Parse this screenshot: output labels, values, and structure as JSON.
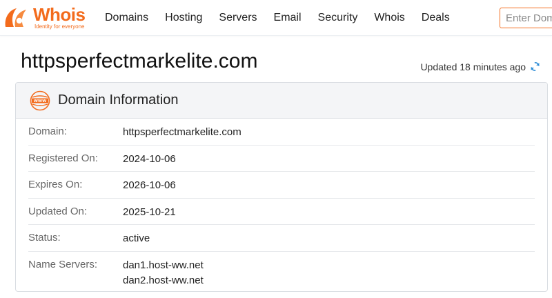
{
  "brand": {
    "name": "Whois",
    "tagline": "Identity for everyone",
    "accent_color": "#f36b1c",
    "icon": "whois-logo-icon"
  },
  "nav": {
    "items": [
      "Domains",
      "Hosting",
      "Servers",
      "Email",
      "Security",
      "Whois",
      "Deals"
    ]
  },
  "search": {
    "placeholder": "Enter Domain or IP",
    "value": ""
  },
  "page": {
    "title": "httpsperfectmarkelite.com",
    "updated_text": "Updated 18 minutes ago",
    "refresh_icon": "refresh-icon",
    "refresh_color": "#2a8bd6"
  },
  "card": {
    "title": "Domain Information",
    "icon": "www-icon",
    "rows": [
      {
        "label": "Domain:",
        "values": [
          "httpsperfectmarkelite.com"
        ]
      },
      {
        "label": "Registered On:",
        "values": [
          "2024-10-06"
        ]
      },
      {
        "label": "Expires On:",
        "values": [
          "2026-10-06"
        ]
      },
      {
        "label": "Updated On:",
        "values": [
          "2025-10-21"
        ]
      },
      {
        "label": "Status:",
        "values": [
          "active"
        ]
      },
      {
        "label": "Name Servers:",
        "values": [
          "dan1.host-ww.net",
          "dan2.host-ww.net"
        ]
      }
    ]
  }
}
